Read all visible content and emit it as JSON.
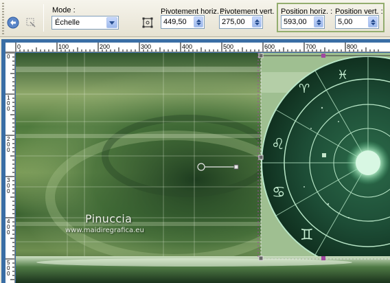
{
  "toolbar": {
    "mode": {
      "label": "Mode :",
      "value": "Échelle"
    },
    "pivot_h": {
      "label": "Pivotement horiz. :",
      "value": "449,50"
    },
    "pivot_v": {
      "label": "Pivotement vert. :",
      "value": "275,00"
    },
    "pos_h": {
      "label": "Position horiz. :",
      "value": "593,00"
    },
    "pos_v": {
      "label": "Position vert. :",
      "value": "5,00"
    }
  },
  "rulers": {
    "top_ticks": [
      "0",
      "100",
      "200",
      "300",
      "400",
      "500",
      "600",
      "700",
      "800"
    ],
    "left_ticks": [
      "0",
      "100",
      "200",
      "300",
      "400",
      "500"
    ]
  },
  "watermark": {
    "name": "Pinuccia",
    "url": "www.maidiregrafica.eu"
  },
  "zodiac_glyphs": [
    "♌",
    "♋",
    "♊",
    "♈",
    "♓"
  ],
  "colors": {
    "highlight": "#93ad6e",
    "frame": "#3a6ea5"
  }
}
